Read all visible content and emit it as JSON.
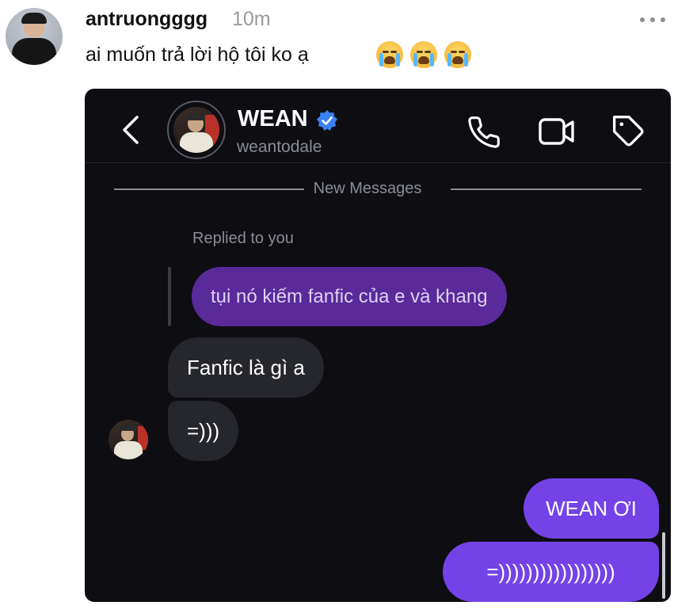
{
  "post": {
    "username": "antruongggg",
    "time": "10m",
    "text": "ai muốn trả lời hộ tôi ko ạ",
    "emojis": [
      "loudly-crying-face-icon",
      "loudly-crying-face-icon",
      "loudly-crying-face-icon"
    ]
  },
  "chat": {
    "header": {
      "name": "WEAN",
      "handle": "weantodale",
      "verified": true,
      "icons": [
        "back-icon",
        "phone-icon",
        "video-icon",
        "tag-icon"
      ]
    },
    "divider_label": "New Messages",
    "reply_label": "Replied to you",
    "quoted_message": "tụi nó kiếm fanfic của e và khang",
    "received": [
      "Fanfic là gì a",
      "=)))"
    ],
    "sent": [
      "WEAN ƠI",
      "=)))))))))))))))))"
    ]
  },
  "colors": {
    "chat_background": "#0d0d12",
    "sent_bubble": "#7443e8",
    "received_bubble": "#26272c",
    "quoted_bubble": "#5a2a9a",
    "verified_badge": "#3b82f6"
  }
}
